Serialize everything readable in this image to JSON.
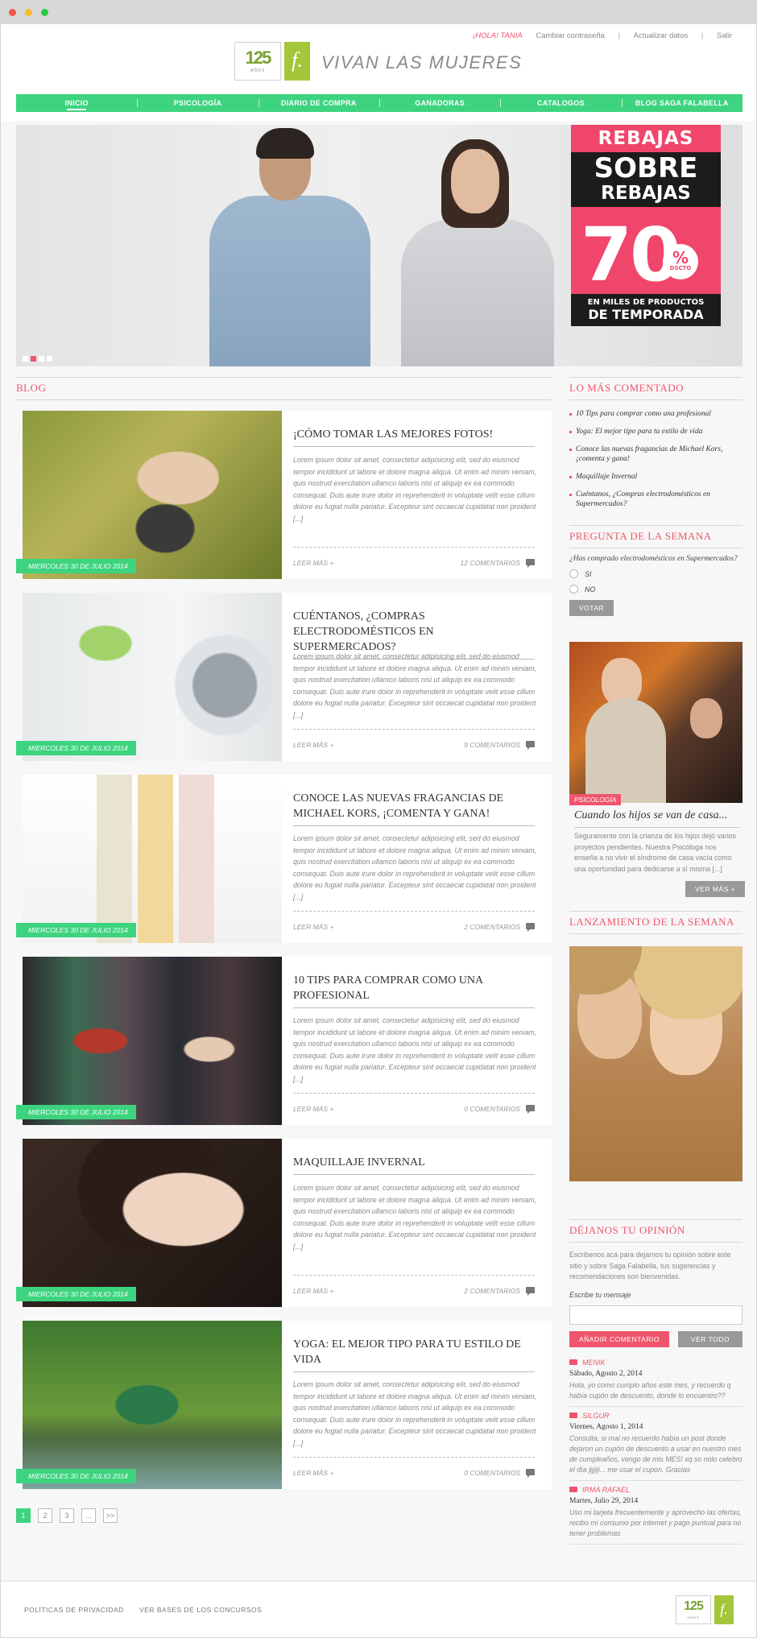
{
  "userbar": {
    "greeting": "¡HOLA! TANIA",
    "change_password": "Cambiar contraseña",
    "update_data": "Actualizar datos",
    "logout": "Salir",
    "separator": "|"
  },
  "brand": {
    "years": "125",
    "years_label": "AÑOS",
    "f_mark": "f.",
    "site_title": "VIVAN LAS MUJERES",
    "accent_green": "#3dd37f",
    "accent_pink": "#f0556c"
  },
  "nav": {
    "items": [
      "INICIO",
      "PSICOLOGÍA",
      "DIARIO DE COMPRA",
      "GANADORAS",
      "CATALOGOS",
      "BLOG SAGA FALABELLA"
    ],
    "active": "INICIO"
  },
  "hero": {
    "promo_line1": "REBAJAS",
    "promo_line2": "SOBRE",
    "promo_line3": "REBAJAS",
    "promo_value": "70",
    "promo_percent": "%",
    "promo_dscto": "DSCTO",
    "promo_bottom1": "EN MILES DE PRODUCTOS",
    "promo_bottom2": "DE TEMPORADA",
    "slides": 4,
    "active_slide": 2
  },
  "blog": {
    "heading": "BLOG",
    "read_more": "LEER MÁS +",
    "posts": [
      {
        "title": "¡CÓMO TOMAR LAS MEJORES FOTOS!",
        "date": "MIERCOLES 30 DE JULIO 2014",
        "comments": "12 COMENTARIOS",
        "excerpt": "Lorem ipsum dolor sit amet, consectetur adipisicing elit, sed do eiusmod tempor incididunt ut labore et dolore magna aliqua. Ut enim ad minim veniam, quis nostrud exercitation ullamco laboris nisi ut aliquip ex ea commodo consequat. Duis aute irure dolor in reprehenderit in voluptate velit esse cillum dolore eu fugiat nulla pariatur. Excepteur sint occaecat cupidatat non proident [...]"
      },
      {
        "title": "CUÉNTANOS, ¿COMPRAS ELECTRODOMÉSTICOS EN SUPERMERCADOS?",
        "date": "MIERCOLES 30 DE JULIO 2014",
        "comments": "9 COMENTARIOS",
        "excerpt": "Lorem ipsum dolor sit amet, consectetur adipisicing elit, sed do eiusmod tempor incididunt ut labore et dolore magna aliqua. Ut enim ad minim veniam, quis nostrud exercitation ullamco laboris nisi ut aliquip ex ea commodo consequat. Duis aute irure dolor in reprehenderit in voluptate velit esse cillum dolore eu fugiat nulla pariatur. Excepteur sint occaecat cupidatat non proident [...]"
      },
      {
        "title": "CONOCE LAS NUEVAS FRAGANCIAS DE MICHAEL KORS, ¡COMENTA Y GANA!",
        "date": "MIERCOLES 30 DE JULIO 2014",
        "comments": "2 COMENTARIOS",
        "excerpt": "Lorem ipsum dolor sit amet, consectetur adipisicing elit, sed do eiusmod tempor incididunt ut labore et dolore magna aliqua. Ut enim ad minim veniam, quis nostrud exercitation ullamco laboris nisi ut aliquip ex ea commodo consequat. Duis aute irure dolor in reprehenderit in voluptate velit esse cillum dolore eu fugiat nulla pariatur. Excepteur sint occaecat cupidatat non proident [...]"
      },
      {
        "title": "10 TIPS PARA COMPRAR COMO UNA PROFESIONAL",
        "date": "MIERCOLES 30 DE JULIO 2014",
        "comments": "0 COMENTARIOS",
        "excerpt": "Lorem ipsum dolor sit amet, consectetur adipisicing elit, sed do eiusmod tempor incididunt ut labore et dolore magna aliqua. Ut enim ad minim veniam, quis nostrud exercitation ullamco laboris nisi ut aliquip ex ea commodo consequat. Duis aute irure dolor in reprehenderit in voluptate velit esse cillum dolore eu fugiat nulla pariatur. Excepteur sint occaecat cupidatat non proident [...]"
      },
      {
        "title": "MAQUILLAJE INVERNAL",
        "date": "MIERCOLES 30 DE JULIO 2014",
        "comments": "2 COMENTARIOS",
        "excerpt": "Lorem ipsum dolor sit amet, consectetur adipisicing elit, sed do eiusmod tempor incididunt ut labore et dolore magna aliqua. Ut enim ad minim veniam, quis nostrud exercitation ullamco laboris nisi ut aliquip ex ea commodo consequat. Duis aute irure dolor in reprehenderit in voluptate velit esse cillum dolore eu fugiat nulla pariatur. Excepteur sint occaecat cupidatat non proident [...]"
      },
      {
        "title": "YOGA: EL MEJOR TIPO PARA TU ESTILO DE VIDA",
        "date": "MIERCOLES 30 DE JULIO 2014",
        "comments": "0 COMENTARIOS",
        "excerpt": "Lorem ipsum dolor sit amet, consectetur adipisicing elit, sed do eiusmod tempor incididunt ut labore et dolore magna aliqua. Ut enim ad minim veniam, quis nostrud exercitation ullamco laboris nisi ut aliquip ex ea commodo consequat. Duis aute irure dolor in reprehenderit in voluptate velit esse cillum dolore eu fugiat nulla pariatur. Excepteur sint occaecat cupidatat non proident [...]"
      }
    ],
    "pagination": [
      "1",
      "2",
      "3",
      "...",
      ">>"
    ],
    "current_page": "1"
  },
  "sidebar": {
    "most_commented": {
      "heading": "LO MÁS COMENTADO",
      "items": [
        "10 Tips para comprar como una profesional",
        "Yoga: El mejor tipo para tu estilo de vida",
        "Conoce las nuevas fragancias de Michael Kors, ¡comenta y gana!",
        "Maquillaje Invernal",
        "Cuéntanos, ¿Compras electrodomésticos en Supermercados?"
      ]
    },
    "poll": {
      "heading": "PREGUNTA DE LA SEMANA",
      "question": "¿Has comprado electrodomésticos en Supermercados?",
      "options": [
        "SI",
        "NO"
      ],
      "vote_label": "VOTAR"
    },
    "feature": {
      "category": "PSICOLOGÍA",
      "title": "Cuando los hijos se van de casa...",
      "text": "Seguramente con la crianza de los hijos dejó varios proyectos pendientes. Nuestra Psicóloga nos enseña a no vivir el síndrome de casa vacía como una oportunidad para dedicarse a sí misma [...]",
      "more_label": "VER MÁS +"
    },
    "launch": {
      "heading": "LANZAMIENTO DE LA SEMANA"
    },
    "opinion": {
      "heading": "DÉJANOS TU OPINIÓN",
      "intro": "Escribenos acá para dejarnos tu opinión sobre este sitio y sobre Saga Falabella, tus sugerencias y recomendaciones son bienvenidas.",
      "input_label": "Escribe tu mensaje",
      "add_label": "AÑADIR COMENTARIO",
      "see_all_label": "VER TODO",
      "comments": [
        {
          "author": "MENIK",
          "date": "Sábado, Agosto 2, 2014",
          "text": "Hola, yo como cumplo años este mes, y recuerdo q había cupón de descuento, donde lo encuentro??"
        },
        {
          "author": "SILGUR",
          "date": "Viernes, Agosto 1, 2014",
          "text": "Consulta, si mal no recuerdo había un post donde dejaron un cupón de descuento a usar en nuestro mes de cumpleaños, vengo de mis MES! xq so nolo celebro el día jijjiji... me usar el cupon. Gracias"
        },
        {
          "author": "IRMA RAFAEL",
          "date": "Martes, Julio 29, 2014",
          "text": "Uso mi tarjeta frecuentemente y aprovecho las ofertas, recibo mi consumo por internet y pago puntual para no tener problemas"
        }
      ]
    }
  },
  "footer": {
    "privacy": "POLÍTICAS DE PRIVACIDAD",
    "contest_rules": "VER BASES DE LOS CONCURSOS"
  }
}
